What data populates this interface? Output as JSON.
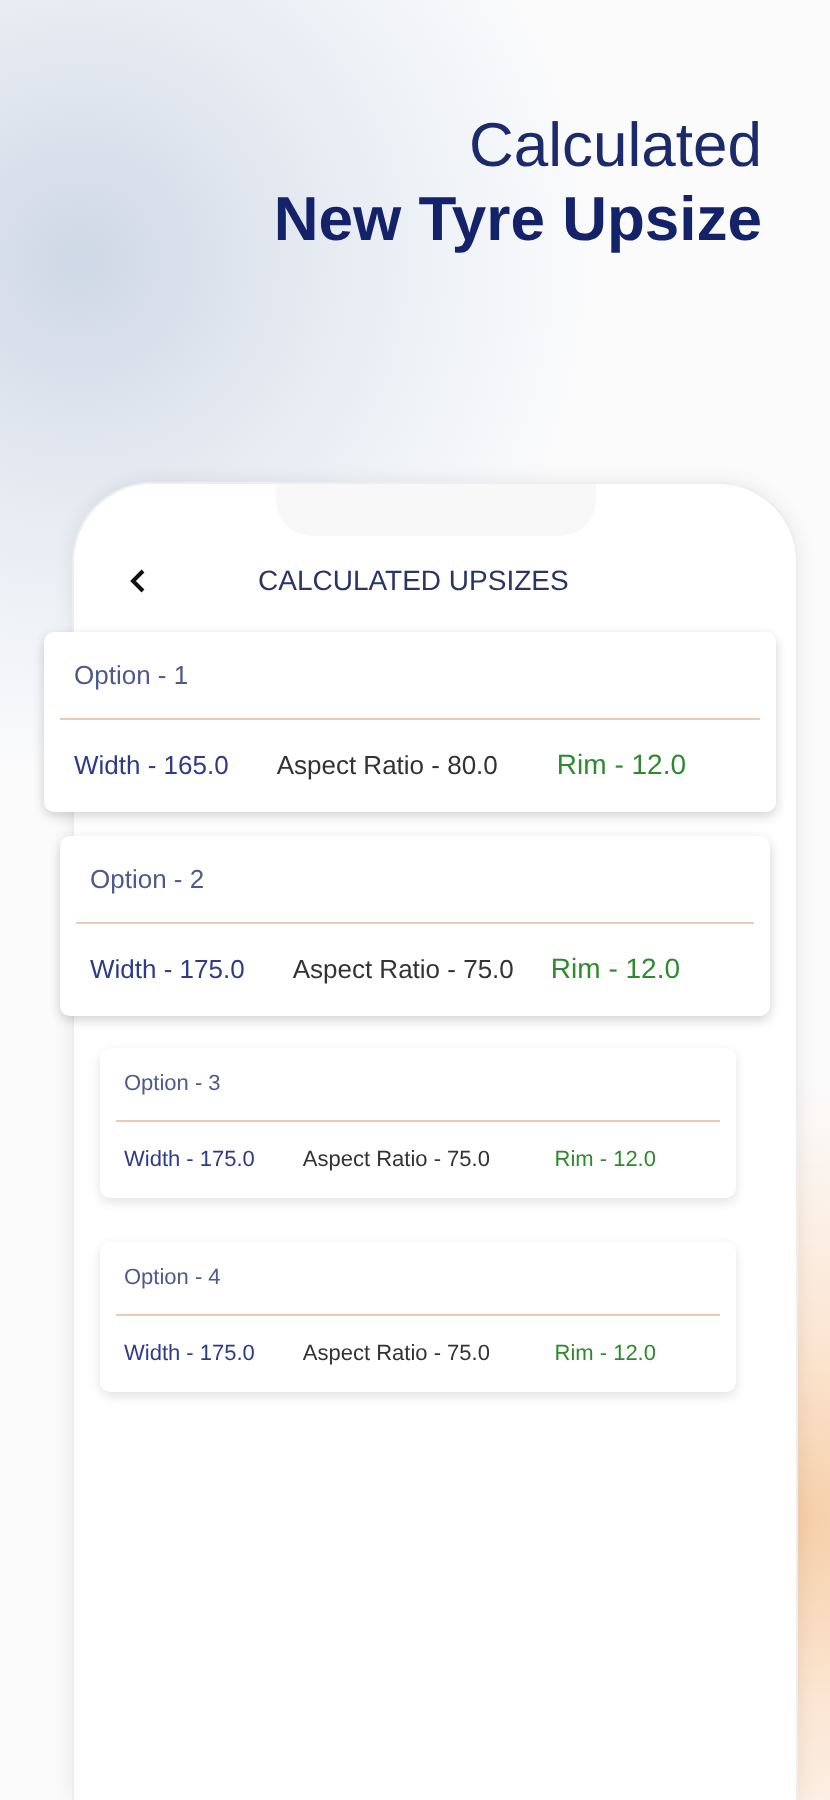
{
  "headline": {
    "line_1": "Calculated",
    "line_2": "New Tyre Upsize"
  },
  "screen": {
    "title": "CALCULATED UPSIZES"
  },
  "options": [
    {
      "kind": "large",
      "title": "Option - 1",
      "width": "Width - 165.0",
      "aspect_ratio": "Aspect Ratio - 80.0",
      "rim": "Rim - 12.0"
    },
    {
      "kind": "medium",
      "title": "Option - 2",
      "width": "Width - 175.0",
      "aspect_ratio": "Aspect Ratio - 75.0",
      "rim": "Rim - 12.0"
    },
    {
      "kind": "small",
      "title": "Option - 3",
      "width": "Width - 175.0",
      "aspect_ratio": "Aspect Ratio - 75.0",
      "rim": "Rim - 12.0"
    },
    {
      "kind": "small",
      "title": "Option - 4",
      "width": "Width - 175.0",
      "aspect_ratio": "Aspect Ratio - 75.0",
      "rim": "Rim - 12.0"
    }
  ]
}
